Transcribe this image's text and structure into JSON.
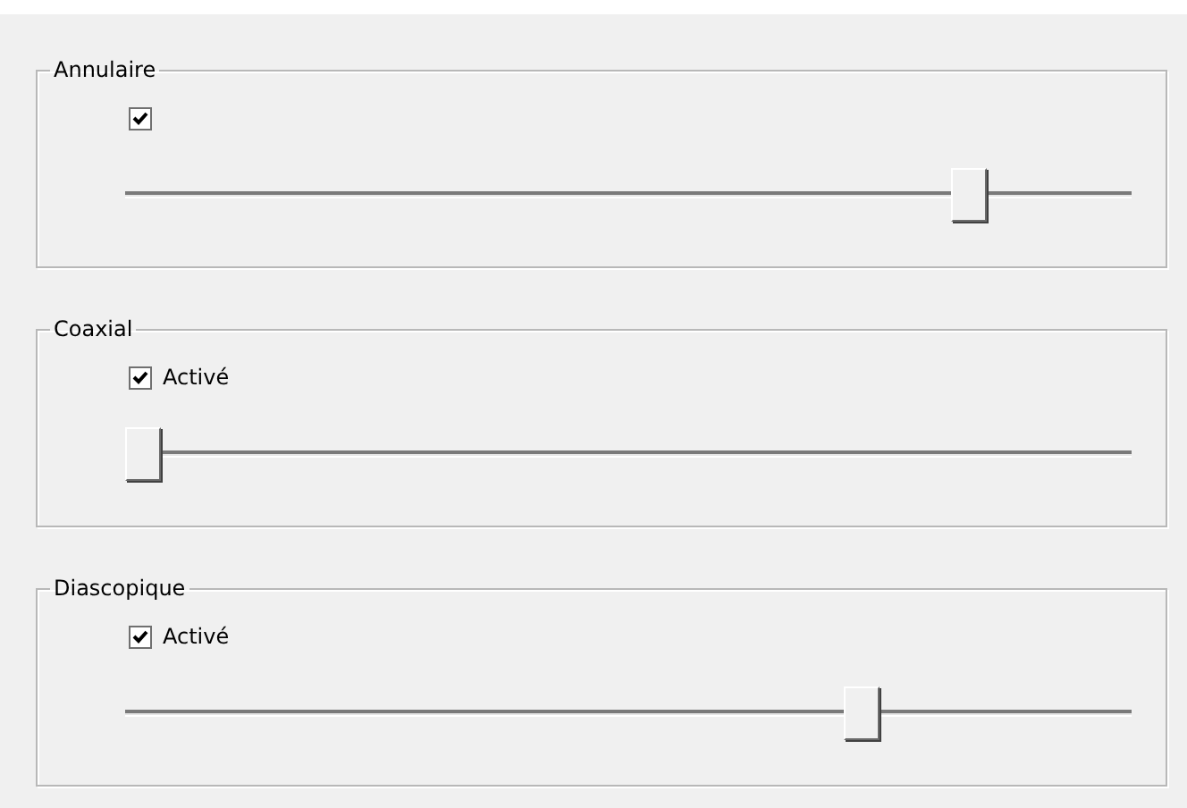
{
  "groups": [
    {
      "title": "Annulaire",
      "checkbox": {
        "checked": true
      },
      "slider": {
        "level": 0.85
      }
    },
    {
      "title": "Coaxial",
      "checkbox": {
        "label": "Activé",
        "checked": true
      },
      "slider": {
        "level": 0
      }
    },
    {
      "title": "Diascopique",
      "checkbox": {
        "label": "Activé",
        "checked": true
      },
      "slider": {
        "level": 0.74
      }
    }
  ]
}
